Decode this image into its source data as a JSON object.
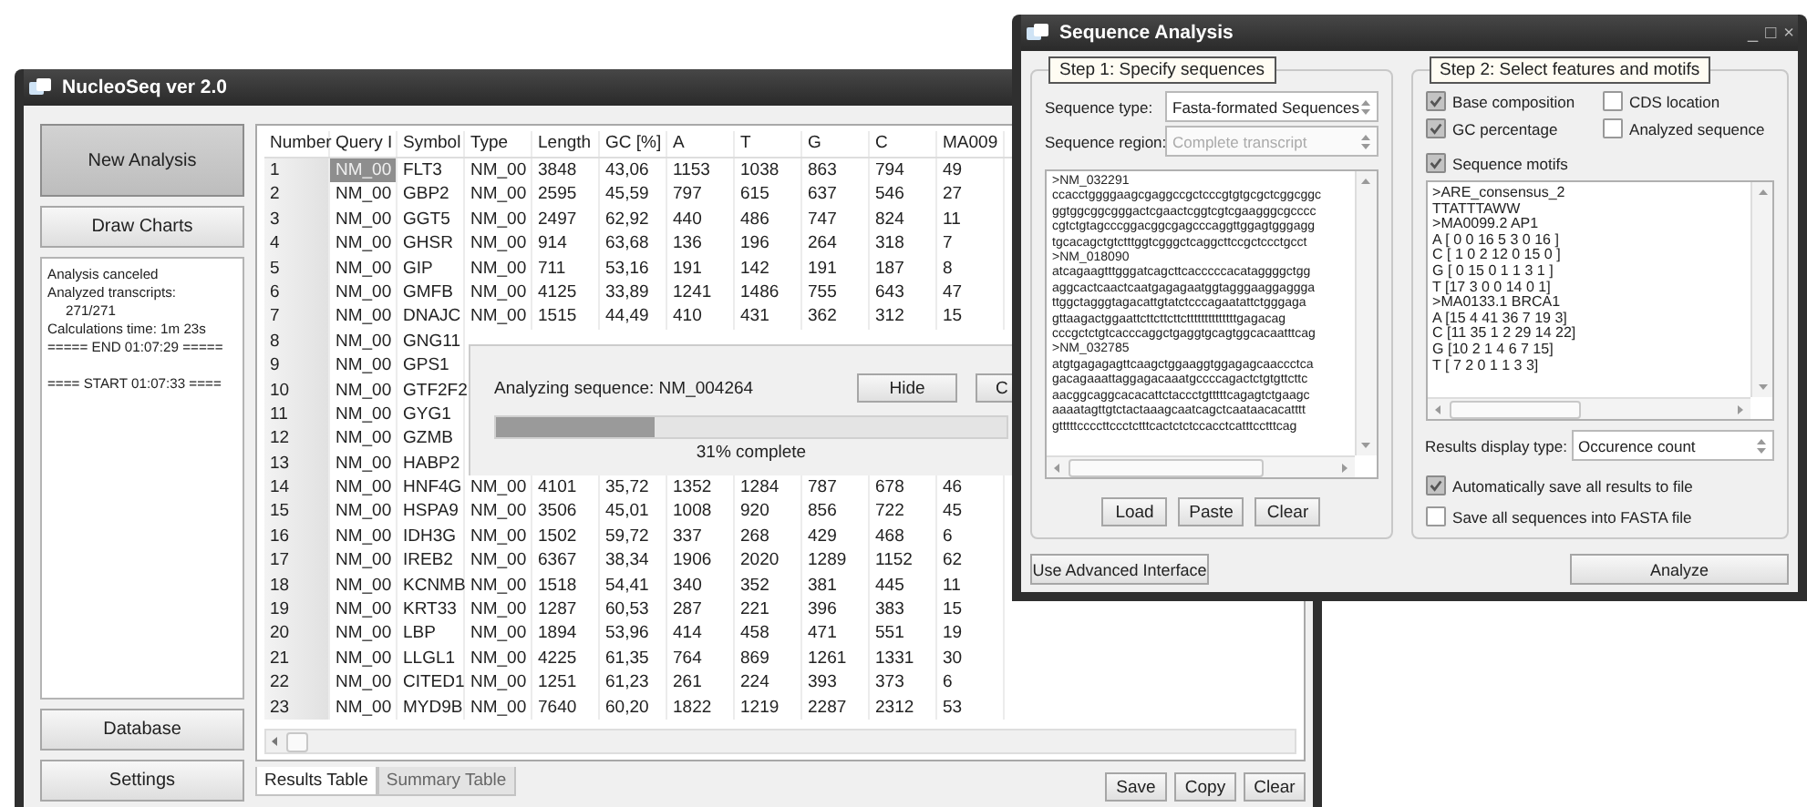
{
  "main_window": {
    "title": "NucleoSeq ver 2.0",
    "sidebar": {
      "top_buttons": [
        "New Analysis",
        "Draw Charts"
      ],
      "log": [
        {
          "text": "Analysis canceled",
          "kind": "line"
        },
        {
          "text": "Analyzed transcripts:",
          "kind": "line"
        },
        {
          "text": "271/271",
          "kind": "indent"
        },
        {
          "text": "Calculations time:  1m 23s",
          "kind": "line"
        },
        {
          "text": "===== END 01:07:29 =====",
          "kind": "line"
        },
        {
          "text": "==== START 01:07:33 ====",
          "kind": "section"
        }
      ],
      "bottom_buttons": [
        "Database",
        "Settings"
      ]
    },
    "table": {
      "columns": [
        "Number",
        "Query I",
        "Symbol",
        "Type",
        "Length",
        "GC [%]",
        "A",
        "T",
        "G",
        "C",
        "MA009"
      ],
      "rows": [
        {
          "cells": [
            "1",
            "NM_00",
            "FLT3",
            "NM_00",
            "3848",
            "43,06",
            "1153",
            "1038",
            "863",
            "794",
            "49"
          ],
          "selected": true
        },
        {
          "cells": [
            "2",
            "NM_00",
            "GBP2",
            "NM_00",
            "2595",
            "45,59",
            "797",
            "615",
            "637",
            "546",
            "27"
          ],
          "selected": false
        },
        {
          "cells": [
            "3",
            "NM_00",
            "GGT5",
            "NM_00",
            "2497",
            "62,92",
            "440",
            "486",
            "747",
            "824",
            "11"
          ],
          "selected": false
        },
        {
          "cells": [
            "4",
            "NM_00",
            "GHSR",
            "NM_00",
            "914",
            "63,68",
            "136",
            "196",
            "264",
            "318",
            "7"
          ],
          "selected": false
        },
        {
          "cells": [
            "5",
            "NM_00",
            "GIP",
            "NM_00",
            "711",
            "53,16",
            "191",
            "142",
            "191",
            "187",
            "8"
          ],
          "selected": false
        },
        {
          "cells": [
            "6",
            "NM_00",
            "GMFB",
            "NM_00",
            "4125",
            "33,89",
            "1241",
            "1486",
            "755",
            "643",
            "47"
          ],
          "selected": false
        },
        {
          "cells": [
            "7",
            "NM_00",
            "DNAJC",
            "NM_00",
            "1515",
            "44,49",
            "410",
            "431",
            "362",
            "312",
            "15"
          ],
          "selected": false
        },
        {
          "cells": [
            "8",
            "NM_00",
            "GNG11"
          ],
          "selected": false
        },
        {
          "cells": [
            "9",
            "NM_00",
            "GPS1"
          ],
          "selected": false
        },
        {
          "cells": [
            "10",
            "NM_00",
            "GTF2F2"
          ],
          "selected": false
        },
        {
          "cells": [
            "11",
            "NM_00",
            "GYG1"
          ],
          "selected": false
        },
        {
          "cells": [
            "12",
            "NM_00",
            "GZMB"
          ],
          "selected": false
        },
        {
          "cells": [
            "13",
            "NM_00",
            "HABP2"
          ],
          "selected": false
        },
        {
          "cells": [
            "14",
            "NM_00",
            "HNF4G",
            "NM_00",
            "4101",
            "35,72",
            "1352",
            "1284",
            "787",
            "678",
            "46"
          ],
          "selected": false
        },
        {
          "cells": [
            "15",
            "NM_00",
            "HSPA9",
            "NM_00",
            "3506",
            "45,01",
            "1008",
            "920",
            "856",
            "722",
            "45"
          ],
          "selected": false
        },
        {
          "cells": [
            "16",
            "NM_00",
            "IDH3G",
            "NM_00",
            "1502",
            "59,72",
            "337",
            "268",
            "429",
            "468",
            "6"
          ],
          "selected": false
        },
        {
          "cells": [
            "17",
            "NM_00",
            "IREB2",
            "NM_00",
            "6367",
            "38,34",
            "1906",
            "2020",
            "1289",
            "1152",
            "62"
          ],
          "selected": false
        },
        {
          "cells": [
            "18",
            "NM_00",
            "KCNMB",
            "NM_00",
            "1518",
            "54,41",
            "340",
            "352",
            "381",
            "445",
            "11"
          ],
          "selected": false
        },
        {
          "cells": [
            "19",
            "NM_00",
            "KRT33",
            "NM_00",
            "1287",
            "60,53",
            "287",
            "221",
            "396",
            "383",
            "15"
          ],
          "selected": false
        },
        {
          "cells": [
            "20",
            "NM_00",
            "LBP",
            "NM_00",
            "1894",
            "53,96",
            "414",
            "458",
            "471",
            "551",
            "19"
          ],
          "selected": false
        },
        {
          "cells": [
            "21",
            "NM_00",
            "LLGL1",
            "NM_00",
            "4225",
            "61,35",
            "764",
            "869",
            "1261",
            "1331",
            "30"
          ],
          "selected": false
        },
        {
          "cells": [
            "22",
            "NM_00",
            "CITED1",
            "NM_00",
            "1251",
            "61,23",
            "261",
            "224",
            "393",
            "373",
            "6"
          ],
          "selected": false
        },
        {
          "cells": [
            "23",
            "NM_00",
            "MYD9B",
            "NM_00",
            "7640",
            "60,20",
            "1822",
            "1219",
            "2287",
            "2312",
            "53"
          ],
          "selected": false
        }
      ]
    },
    "tabs": [
      {
        "label": "Results Table",
        "selected": true
      },
      {
        "label": "Summary Table",
        "selected": false
      }
    ],
    "buttons": [
      "Save",
      "Copy",
      "Clear"
    ]
  },
  "progress_dialog": {
    "message": "Analyzing sequence: NM_004264",
    "buttons": [
      "Hide",
      "C"
    ],
    "level": 0.31,
    "reading": "31% complete"
  },
  "sequence_window": {
    "title": "Sequence Analysis",
    "controls": [
      "_",
      "□",
      "×"
    ],
    "step1": {
      "legend": "Step 1: Specify sequences",
      "fields": [
        {
          "label": "Sequence type:",
          "value": "Fasta-formated Sequences",
          "disabled": false
        },
        {
          "label": "Sequence region:",
          "value": "Complete transcript",
          "disabled": true
        }
      ],
      "sequence_lines": [
        ">NM_032291",
        "ccacctggggaagcgaggccgctcccgtgtgcgctcggcggc",
        "ggtggcggcgggactcgaactcggtcgtcgaagggcgcccc",
        "cgtctgtagcccggacggcgagcccaggttggagtgggagg",
        "tgcacagctgtctttggtcgggctcaggcttccgctccctgcct",
        ">NM_018090",
        "atcagaagtttgggatcagcttcacccccacataggggctgg",
        "aggcactcaactcaatgagagaatggtagggaaggaggga",
        "ttggctagggtagacattgtatctcccagaatattctgggaga",
        "gttaagactggaattcttcttcttcttttttttttttttgagacag",
        "cccgctctgtcacccaggctgaggtgcagtggcacaatttcag",
        ">NM_032785",
        "atgtgagagagttcaagctggaaggtggagagcaaccctca",
        "gacagaaattaggagacaaatgccccagactctgtgttcttc",
        "aacggcaggcacacattctaccctgtttttcagagtctgaagc",
        "aaaatagttgtctactaaagcaatcagctcaataacacatttt",
        "gtttttccccttccctctttcactctctccacctcatttcctttcag"
      ],
      "buttons": [
        "Load",
        "Paste",
        "Clear"
      ]
    },
    "step2": {
      "legend": "Step 2: Select features and motifs",
      "features": [
        {
          "label": "Base composition",
          "checked": true
        },
        {
          "label": "CDS location",
          "checked": false
        },
        {
          "label": "GC percentage",
          "checked": true
        },
        {
          "label": "Analyzed sequence",
          "checked": false
        }
      ],
      "motifs": {
        "label": "Sequence motifs",
        "checked": true
      },
      "motif_lines": [
        ">ARE_consensus_2",
        "TTATTTAWW",
        ">MA0099.2 AP1",
        "A [ 0 0 16 5 3 0 16 ]",
        "C [ 1 0 2 12 0 15 0 ]",
        "G [ 0 15 0 1 1 3 1 ]",
        "T [17 3 0 0 14 0 1]",
        ">MA0133.1 BRCA1",
        "A [15 4 41 36 7 19 3]",
        "C [11 35 1 2 29 14 22]",
        "G [10 2 1 4 6 7 15]",
        "T [ 7 2 0 1 1 3 3]"
      ],
      "display_type": {
        "label": "Results display type:",
        "value": "Occurence count"
      },
      "options": [
        {
          "label": "Automatically save all results to file",
          "checked": true
        },
        {
          "label": "Save all sequences into FASTA file",
          "checked": false
        }
      ]
    },
    "buttons": [
      "Use Advanced Interface",
      "Analyze"
    ]
  }
}
